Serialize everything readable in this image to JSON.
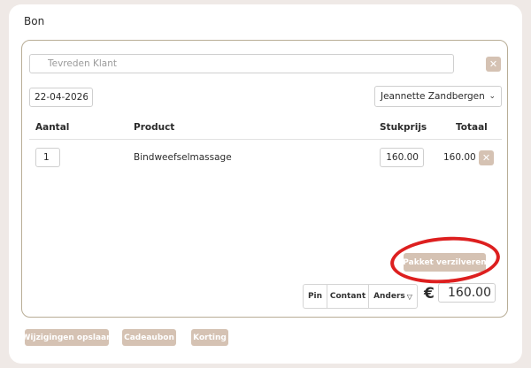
{
  "page": {
    "title": "Bon"
  },
  "customer": {
    "placeholder": "Tevreden Klant",
    "value": ""
  },
  "date": {
    "value": "22-04-2026"
  },
  "employee": {
    "selected": "Jeannette Zandbergen"
  },
  "table": {
    "headers": {
      "qty": "Aantal",
      "product": "Product",
      "unit_price": "Stukprijs",
      "total": "Totaal"
    },
    "rows": [
      {
        "qty": "1",
        "product": "Bindweefselmassage",
        "unit_price": "160.00",
        "total": "160.00"
      }
    ]
  },
  "actions": {
    "sell_package": "Pakket verzilveren"
  },
  "payment": {
    "methods": [
      "Pin",
      "Contant",
      "Anders"
    ],
    "currency_symbol": "€",
    "total": "160.00"
  },
  "footer": {
    "save": "Wijzigingen opslaan",
    "gift_voucher": "Cadeaubon",
    "discount": "Korting"
  },
  "icons": {
    "remove": "close-icon",
    "dropdown": "chevron-down-icon"
  },
  "colors": {
    "button_bg": "#d5c2b3",
    "card_border": "#b8ad96",
    "highlight": "#dd1f1f",
    "page_bg": "#efe9e6"
  }
}
